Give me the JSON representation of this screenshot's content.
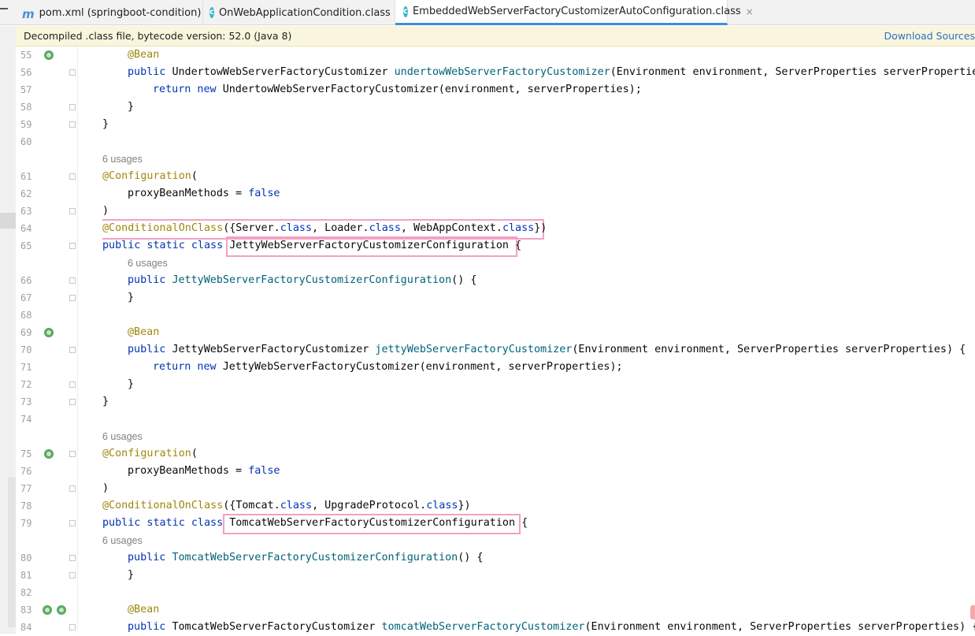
{
  "tabs": [
    {
      "label": "pom.xml (springboot-condition)",
      "icon": "maven-icon",
      "active": false,
      "close": ""
    },
    {
      "label": "OnWebApplicationCondition.class",
      "icon": "class-icon",
      "active": false,
      "close": "×"
    },
    {
      "label": "EmbeddedWebServerFactoryCustomizerAutoConfiguration.class",
      "icon": "class-icon",
      "active": true,
      "close": "×"
    }
  ],
  "notice": {
    "message": "Decompiled .class file, bytecode version: 52.0 (Java 8)",
    "download": "Download Sources"
  },
  "colors": {
    "annotation": "#9e880d",
    "keyword": "#0033b3",
    "method": "#00627a",
    "highlight": "#f2a1c4"
  },
  "lines": [
    {
      "n": "55",
      "tokens": [
        [
          "ann",
          "@Bean"
        ]
      ]
    },
    {
      "n": "56",
      "tokens": [
        [
          "kw",
          "public "
        ],
        [
          "",
          "UndertowWebServerFactoryCustomizer "
        ],
        [
          "mth",
          "undertowWebServerFactoryCustomizer"
        ],
        [
          "",
          "(Environment environment, ServerProperties serverProperties"
        ]
      ]
    },
    {
      "n": "57",
      "tokens": [
        [
          "kw",
          "return new "
        ],
        [
          "",
          "UndertowWebServerFactoryCustomizer(environment, serverProperties);"
        ]
      ]
    },
    {
      "n": "58",
      "tokens": [
        [
          "",
          "}"
        ]
      ]
    },
    {
      "n": "59",
      "tokens": [
        [
          "",
          "}"
        ]
      ]
    },
    {
      "n": "60",
      "tokens": []
    },
    {
      "n": "",
      "usage": "6 usages"
    },
    {
      "n": "61",
      "tokens": [
        [
          "ann",
          "@Configuration"
        ],
        [
          "",
          "("
        ]
      ]
    },
    {
      "n": "62",
      "tokens": [
        [
          "",
          "proxyBeanMethods = "
        ],
        [
          "kw",
          "false"
        ]
      ]
    },
    {
      "n": "63",
      "tokens": [
        [
          "",
          ")"
        ]
      ]
    },
    {
      "n": "64",
      "tokens": [
        [
          "ann",
          "@ConditionalOnClass"
        ],
        [
          "",
          "({Server."
        ],
        [
          "kw",
          "class"
        ],
        [
          "",
          ", Loader."
        ],
        [
          "kw",
          "class"
        ],
        [
          "",
          ", WebAppContext."
        ],
        [
          "kw",
          "class"
        ],
        [
          "",
          "})"
        ]
      ]
    },
    {
      "n": "65",
      "tokens": [
        [
          "kw",
          "public static class "
        ],
        [
          "",
          "JettyWebServerFactoryCustomizerConfiguration {"
        ]
      ]
    },
    {
      "n": "",
      "usage": "6 usages"
    },
    {
      "n": "66",
      "tokens": [
        [
          "kw",
          "public "
        ],
        [
          "mth",
          "JettyWebServerFactoryCustomizerConfiguration"
        ],
        [
          "",
          "() {"
        ]
      ]
    },
    {
      "n": "67",
      "tokens": [
        [
          "",
          "}"
        ]
      ]
    },
    {
      "n": "68",
      "tokens": []
    },
    {
      "n": "69",
      "tokens": [
        [
          "ann",
          "@Bean"
        ]
      ]
    },
    {
      "n": "70",
      "tokens": [
        [
          "kw",
          "public "
        ],
        [
          "",
          "JettyWebServerFactoryCustomizer "
        ],
        [
          "mth",
          "jettyWebServerFactoryCustomizer"
        ],
        [
          "",
          "(Environment environment, ServerProperties serverProperties) {"
        ]
      ]
    },
    {
      "n": "71",
      "tokens": [
        [
          "kw",
          "return new "
        ],
        [
          "",
          "JettyWebServerFactoryCustomizer(environment, serverProperties);"
        ]
      ]
    },
    {
      "n": "72",
      "tokens": [
        [
          "",
          "}"
        ]
      ]
    },
    {
      "n": "73",
      "tokens": [
        [
          "",
          "}"
        ]
      ]
    },
    {
      "n": "74",
      "tokens": []
    },
    {
      "n": "",
      "usage": "6 usages"
    },
    {
      "n": "75",
      "tokens": [
        [
          "ann",
          "@Configuration"
        ],
        [
          "",
          "("
        ]
      ]
    },
    {
      "n": "76",
      "tokens": [
        [
          "",
          "proxyBeanMethods = "
        ],
        [
          "kw",
          "false"
        ]
      ]
    },
    {
      "n": "77",
      "tokens": [
        [
          "",
          ")"
        ]
      ]
    },
    {
      "n": "78",
      "tokens": [
        [
          "ann",
          "@ConditionalOnClass"
        ],
        [
          "",
          "({Tomcat."
        ],
        [
          "kw",
          "class"
        ],
        [
          "",
          ", UpgradeProtocol."
        ],
        [
          "kw",
          "class"
        ],
        [
          "",
          "})"
        ]
      ]
    },
    {
      "n": "79",
      "tokens": [
        [
          "kw",
          "public static class "
        ],
        [
          "",
          "TomcatWebServerFactoryCustomizerConfiguration {"
        ]
      ]
    },
    {
      "n": "",
      "usage": "6 usages"
    },
    {
      "n": "80",
      "tokens": [
        [
          "kw",
          "public "
        ],
        [
          "mth",
          "TomcatWebServerFactoryCustomizerConfiguration"
        ],
        [
          "",
          "() {"
        ]
      ]
    },
    {
      "n": "81",
      "tokens": [
        [
          "",
          "}"
        ]
      ]
    },
    {
      "n": "82",
      "tokens": []
    },
    {
      "n": "83",
      "tokens": [
        [
          "ann",
          "@Bean"
        ]
      ]
    },
    {
      "n": "84",
      "tokens": [
        [
          "kw",
          "public "
        ],
        [
          "",
          "TomcatWebServerFactoryCustomizer "
        ],
        [
          "mth",
          "tomcatWebServerFactoryCustomizer"
        ],
        [
          "",
          "(Environment environment, ServerProperties serverProperties) {"
        ]
      ]
    }
  ]
}
